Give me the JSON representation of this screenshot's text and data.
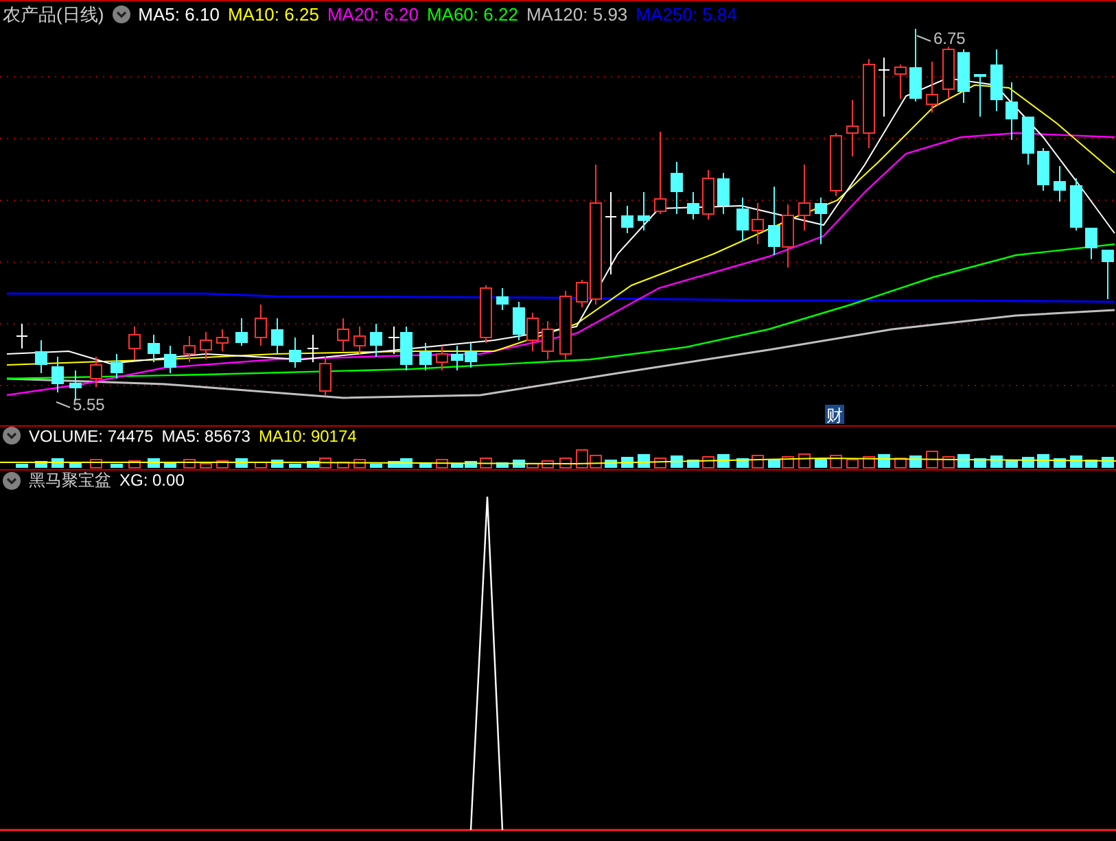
{
  "main_panel": {
    "title": "农产品(日线)",
    "indicators": [
      {
        "label": "MA5: 6.10",
        "color": "#ffffff"
      },
      {
        "label": "MA10: 6.25",
        "color": "#ffff00"
      },
      {
        "label": "MA20: 6.20",
        "color": "#ff00ff"
      },
      {
        "label": "MA60: 6.22",
        "color": "#00ff00"
      },
      {
        "label": "MA120: 5.93",
        "color": "#c0c0c0"
      },
      {
        "label": "MA250: 5.84",
        "color": "#0000ff"
      }
    ],
    "high_marker": "6.75",
    "low_marker": "5.55",
    "badge": "财"
  },
  "volume_panel": {
    "indicators": [
      {
        "label": "VOLUME: 74475",
        "color": "#ffffff"
      },
      {
        "label": "MA5: 85673",
        "color": "#ffffff"
      },
      {
        "label": "MA10: 90174",
        "color": "#ffff00"
      }
    ]
  },
  "indicator_panel": {
    "title": "黑马聚宝盆",
    "indicators": [
      {
        "label": "XG: 0.00",
        "color": "#ffffff"
      }
    ]
  }
}
